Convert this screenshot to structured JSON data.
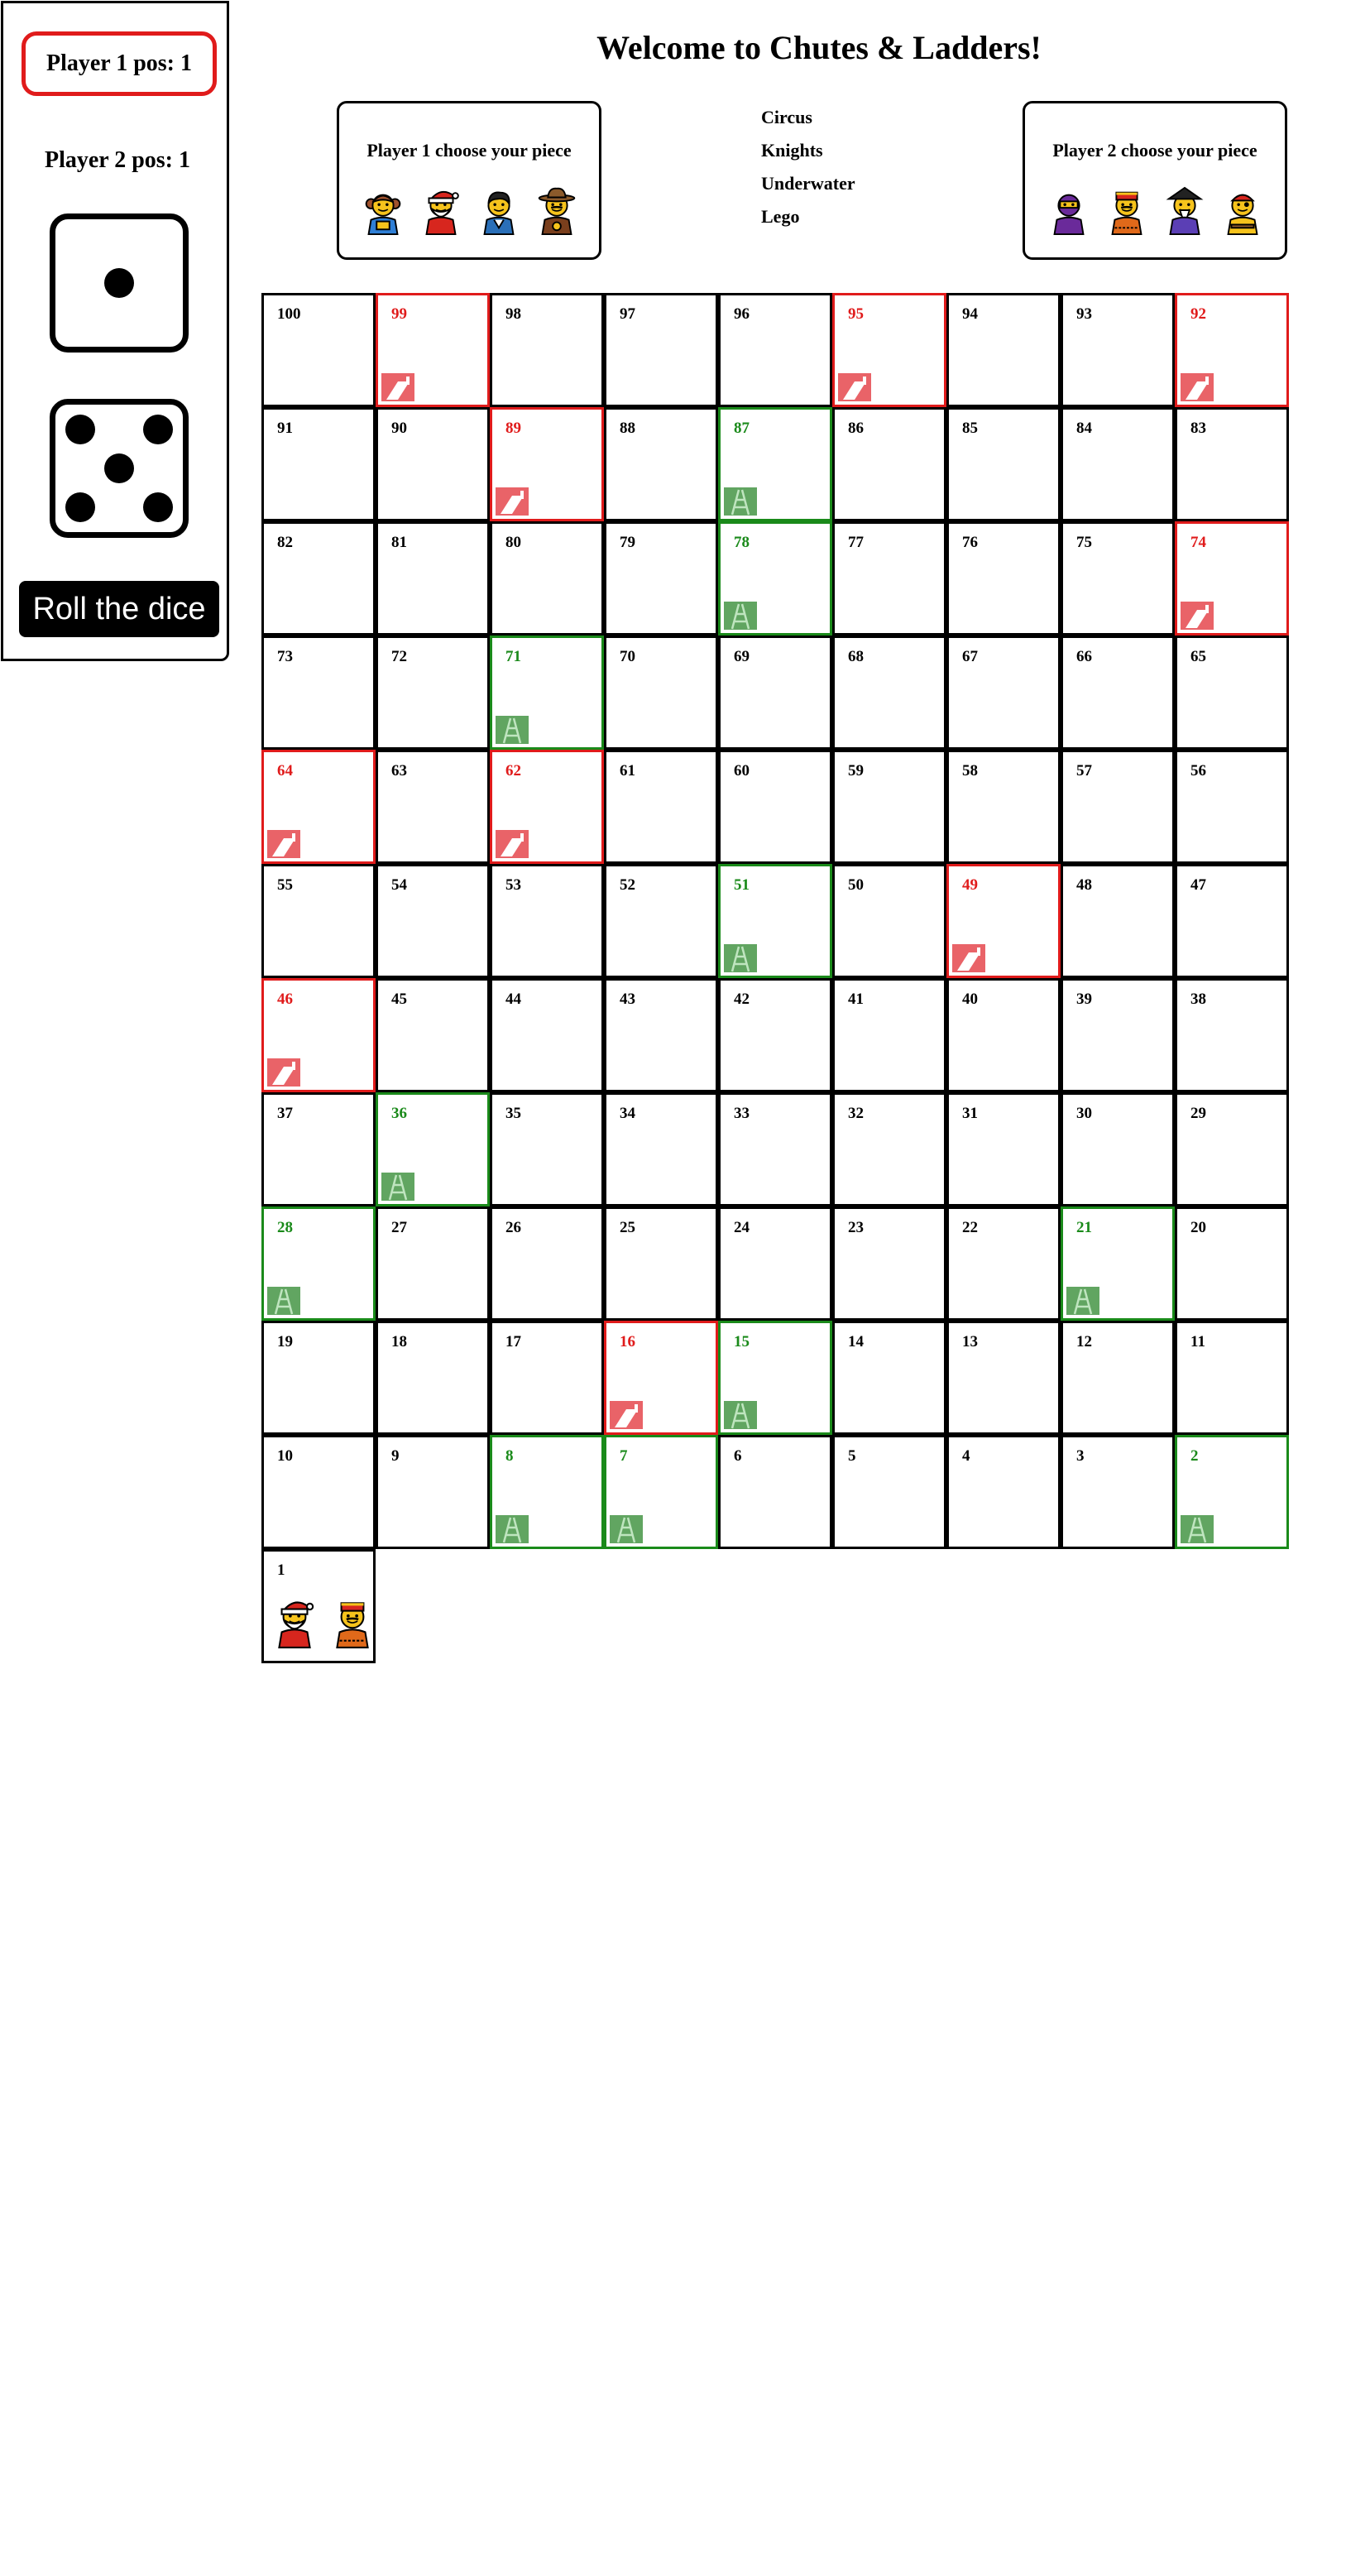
{
  "side_panel": {
    "player1_pos": "Player 1 pos: 1",
    "player2_pos": "Player 2 pos: 1",
    "dice": [
      1,
      5
    ],
    "roll_button": "Roll the dice"
  },
  "header": {
    "title": "Welcome to Chutes & Ladders!",
    "player1_box_title": "Player 1 choose your piece",
    "player2_box_title": "Player 2 choose your piece",
    "player1_pieces": [
      "girl-minifig-icon",
      "santa-minifig-icon",
      "boy-minifig-icon",
      "cowboy-minifig-icon"
    ],
    "player2_pieces": [
      "ninja-minifig-icon",
      "chief-minifig-icon",
      "wizard-minifig-icon",
      "pirate-minifig-icon"
    ],
    "themes": [
      "Circus",
      "Knights",
      "Underwater",
      "Lego"
    ]
  },
  "board": {
    "rows": [
      [
        "100",
        "99",
        "98",
        "97",
        "96",
        "95",
        "94",
        "93",
        "92"
      ],
      [
        "91",
        "90",
        "89",
        "88",
        "87",
        "86",
        "85",
        "84",
        "83"
      ],
      [
        "82",
        "81",
        "80",
        "79",
        "78",
        "77",
        "76",
        "75",
        "74"
      ],
      [
        "73",
        "72",
        "71",
        "70",
        "69",
        "68",
        "67",
        "66",
        "65"
      ],
      [
        "64",
        "63",
        "62",
        "61",
        "60",
        "59",
        "58",
        "57",
        "56"
      ],
      [
        "55",
        "54",
        "53",
        "52",
        "51",
        "50",
        "49",
        "48",
        "47"
      ],
      [
        "46",
        "45",
        "44",
        "43",
        "42",
        "41",
        "40",
        "39",
        "38"
      ],
      [
        "37",
        "36",
        "35",
        "34",
        "33",
        "32",
        "31",
        "30",
        "29"
      ],
      [
        "28",
        "27",
        "26",
        "25",
        "24",
        "23",
        "22",
        "21",
        "20"
      ],
      [
        "19",
        "18",
        "17",
        "16",
        "15",
        "14",
        "13",
        "12",
        "11"
      ],
      [
        "10",
        "9",
        "8",
        "7",
        "6",
        "5",
        "4",
        "3",
        "2"
      ],
      [
        "1"
      ]
    ],
    "chutes": [
      "99",
      "95",
      "92",
      "89",
      "74",
      "64",
      "62",
      "49",
      "46",
      "16"
    ],
    "ladders": [
      "87",
      "78",
      "71",
      "51",
      "36",
      "28",
      "21",
      "15",
      "8",
      "7",
      "2"
    ],
    "occupants": {
      "1": [
        "santa-minifig-icon",
        "chief-minifig-icon"
      ]
    }
  },
  "colors": {
    "chute": "#e01b1b",
    "ladder": "#1a8a1a",
    "active_player_outline": "#e01b1b"
  }
}
